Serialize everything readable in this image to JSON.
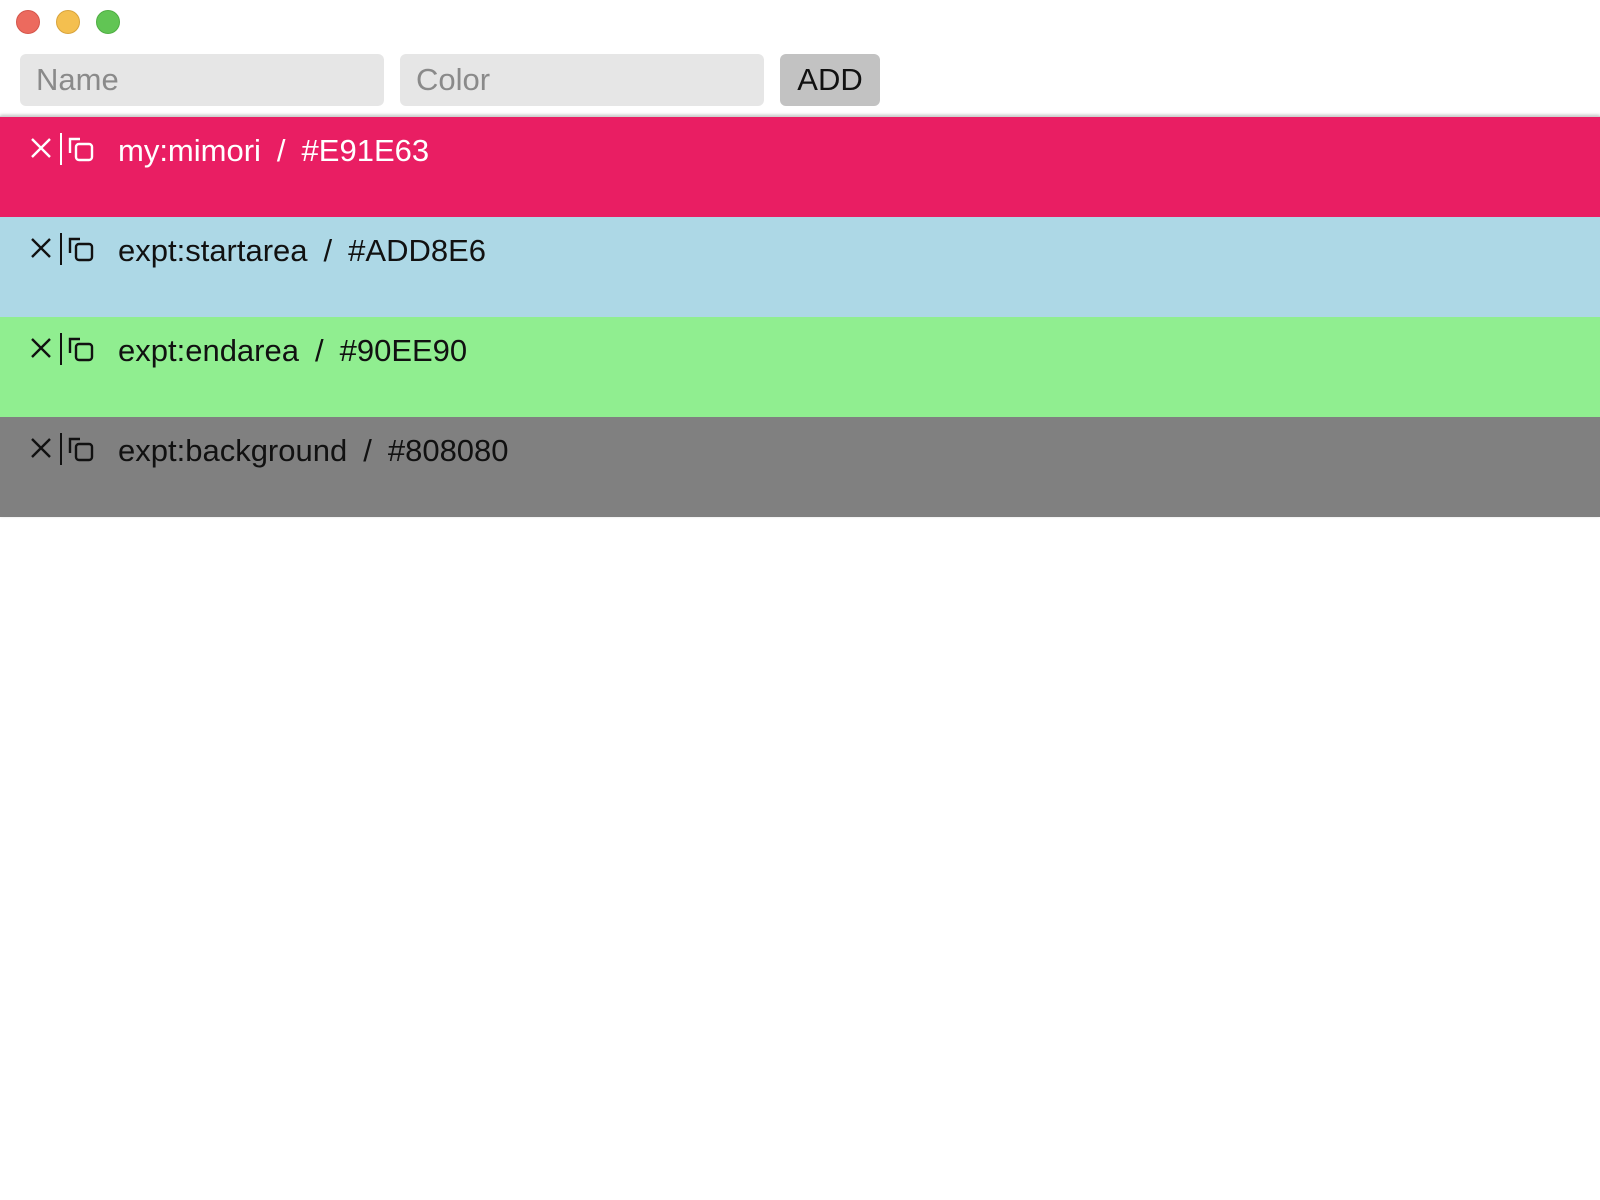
{
  "window": {
    "buttons": [
      "close",
      "minimize",
      "maximize"
    ]
  },
  "form": {
    "name_placeholder": "Name",
    "color_placeholder": "Color",
    "add_label": "ADD"
  },
  "entries": [
    {
      "name": "my:mimori",
      "color": "#E91E63",
      "text_color": "#ffffff",
      "delete_icon": "close-icon",
      "copy_icon": "copy-icon"
    },
    {
      "name": "expt:startarea",
      "color": "#ADD8E6",
      "text_color": "#111111",
      "delete_icon": "close-icon",
      "copy_icon": "copy-icon"
    },
    {
      "name": "expt:endarea",
      "color": "#90EE90",
      "text_color": "#111111",
      "delete_icon": "close-icon",
      "copy_icon": "copy-icon"
    },
    {
      "name": "expt:background",
      "color": "#808080",
      "text_color": "#111111",
      "delete_icon": "close-icon",
      "copy_icon": "copy-icon"
    }
  ],
  "separator": "/"
}
